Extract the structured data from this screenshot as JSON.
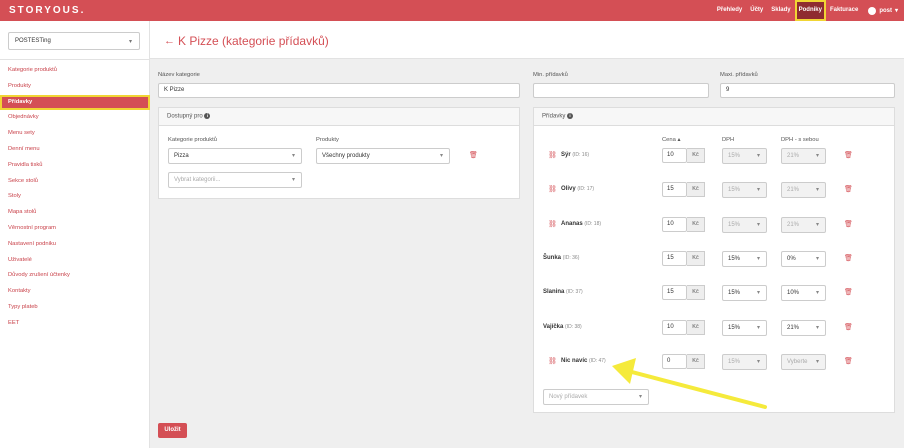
{
  "brand": "STORYOUS.",
  "nav": {
    "items": [
      "Přehledy",
      "Účty",
      "Sklady",
      "Podniky",
      "Fakturace"
    ],
    "active_index": 3,
    "user": "post"
  },
  "sidebar": {
    "restaurant": "POSTESTing",
    "active_index": 2,
    "items": [
      "Kategorie produktů",
      "Produkty",
      "Přídavky",
      "Objednávky",
      "Menu sety",
      "Denní menu",
      "Pravidla tisků",
      "Sekce stolů",
      "Stoly",
      "Mapa stolů",
      "Věrnostní program",
      "Nastavení podniku",
      "Uživatelé",
      "Důvody zrušení účtenky",
      "Kontakty",
      "Typy plateb",
      "EET"
    ]
  },
  "page": {
    "back_icon": "←",
    "title": "K Pizze (kategorie přídavků)"
  },
  "form": {
    "name_label": "Název kategorie",
    "name_value": "K Pizze",
    "min_label": "Min. přídavků",
    "min_value": "",
    "max_label": "Maxi. přídavků",
    "max_value": "9"
  },
  "availability": {
    "title": "Dostupný pro",
    "cat_label": "Kategorie produktů",
    "prod_label": "Produkty",
    "cat_value": "Pizza",
    "prod_value": "Všechny produkty",
    "cat_placeholder": "Vybrat kategorii..."
  },
  "addons": {
    "title": "Přídavky",
    "col_price": "Cena",
    "col_vat": "DPH",
    "col_vat2": "DPH - s sebou",
    "currency": "Kč",
    "rows": [
      {
        "name": "Sýr",
        "id": "(ID: 16)",
        "linked": true,
        "price": "10",
        "vat": "15%",
        "vat2": "21%",
        "disabled": true
      },
      {
        "name": "Olivy",
        "id": "(ID: 17)",
        "linked": true,
        "price": "15",
        "vat": "15%",
        "vat2": "21%",
        "disabled": true
      },
      {
        "name": "Ananas",
        "id": "(ID: 18)",
        "linked": true,
        "price": "10",
        "vat": "15%",
        "vat2": "21%",
        "disabled": true
      },
      {
        "name": "Šunka",
        "id": "(ID: 36)",
        "linked": false,
        "price": "15",
        "vat": "15%",
        "vat2": "0%",
        "disabled": false
      },
      {
        "name": "Slanina",
        "id": "(ID: 37)",
        "linked": false,
        "price": "15",
        "vat": "15%",
        "vat2": "10%",
        "disabled": false
      },
      {
        "name": "Vajíčka",
        "id": "(ID: 38)",
        "linked": false,
        "price": "10",
        "vat": "15%",
        "vat2": "21%",
        "disabled": false
      },
      {
        "name": "Nic navíc",
        "id": "(ID: 47)",
        "linked": true,
        "price": "0",
        "vat": "15%",
        "vat2": "Vyberte",
        "disabled": true
      }
    ],
    "new_placeholder": "Nový přídavek"
  },
  "save_label": "Uložit",
  "colors": {
    "accent": "#d44f55",
    "highlight": "#f1d534"
  }
}
